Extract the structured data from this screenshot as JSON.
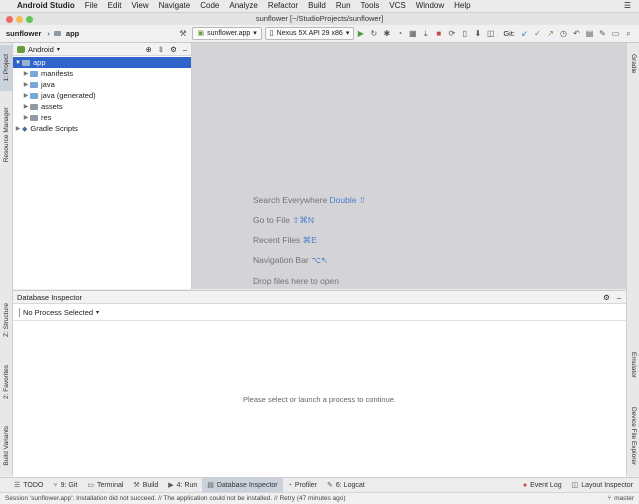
{
  "menubar": {
    "app_name": "Android Studio",
    "items": [
      "File",
      "Edit",
      "View",
      "Navigate",
      "Code",
      "Analyze",
      "Refactor",
      "Build",
      "Run",
      "Tools",
      "VCS",
      "Window",
      "Help"
    ]
  },
  "window": {
    "title": "sunflower [~/StudioProjects/sunflower]"
  },
  "toolbar": {
    "crumb_project": "sunflower",
    "crumb_module": "app",
    "run_config": "sunflower.app",
    "device": "Nexus 5X API 29 x86",
    "git_label": "Git:"
  },
  "left_tabs": {
    "project": "1: Project",
    "resource_manager": "Resource Manager",
    "structure": "Z: Structure",
    "favorites": "2: Favorites",
    "build_variants": "Build Variants"
  },
  "right_tabs": {
    "gradle": "Gradle",
    "emulator": "Emulator",
    "device_file_explorer": "Device File Explorer"
  },
  "project_panel": {
    "view_mode": "Android",
    "tree": [
      {
        "label": "app",
        "level": 0,
        "expanded": true,
        "selected": true
      },
      {
        "label": "manifests",
        "level": 1,
        "expanded": false,
        "selected": false
      },
      {
        "label": "java",
        "level": 1,
        "expanded": false,
        "selected": false
      },
      {
        "label": "java (generated)",
        "level": 1,
        "expanded": false,
        "selected": false
      },
      {
        "label": "assets",
        "level": 1,
        "expanded": false,
        "selected": false
      },
      {
        "label": "res",
        "level": 1,
        "expanded": false,
        "selected": false
      },
      {
        "label": "Gradle Scripts",
        "level": 0,
        "expanded": false,
        "selected": false
      }
    ]
  },
  "editor_hints": {
    "search_everywhere": "Search Everywhere",
    "search_everywhere_key": "Double ⇧",
    "go_to_file": "Go to File",
    "go_to_file_key": "⇧⌘N",
    "recent_files": "Recent Files",
    "recent_files_key": "⌘E",
    "navigation_bar": "Navigation Bar",
    "navigation_bar_key": "⌥↖",
    "drop_files": "Drop files here to open"
  },
  "database_inspector": {
    "title": "Database Inspector",
    "process_select": "No Process Selected",
    "empty_message": "Please select or launch a process to continue."
  },
  "bottom_tabs": [
    "TODO",
    "9: Git",
    "Terminal",
    "Build",
    "4: Run",
    "Database Inspector",
    "Profiler",
    "6: Logcat"
  ],
  "bottom_right_tabs": [
    "Event Log",
    "Layout Inspector"
  ],
  "status": {
    "message": "Session 'sunflower.app': Installation did not succeed. // The application could not be installed. // Retry (47 minutes ago)",
    "branch": "master"
  },
  "colors": {
    "selection": "#2f65ca",
    "editor_bg": "#d4d4d7",
    "hint_text": "#737378",
    "shortcut_text": "#4a7ed0",
    "run_green": "#4f9a3e"
  }
}
